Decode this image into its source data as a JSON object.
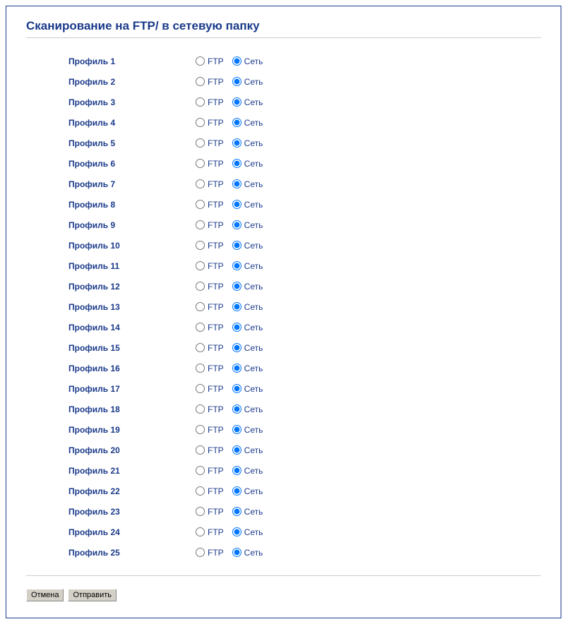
{
  "title": "Сканирование на FTP/ в сетевую папку",
  "labels": {
    "ftp": "FTP",
    "network": "Сеть"
  },
  "profiles": [
    {
      "label": "Профиль 1",
      "selected": "network"
    },
    {
      "label": "Профиль 2",
      "selected": "network"
    },
    {
      "label": "Профиль 3",
      "selected": "network"
    },
    {
      "label": "Профиль 4",
      "selected": "network"
    },
    {
      "label": "Профиль 5",
      "selected": "network"
    },
    {
      "label": "Профиль 6",
      "selected": "network"
    },
    {
      "label": "Профиль 7",
      "selected": "network"
    },
    {
      "label": "Профиль 8",
      "selected": "network"
    },
    {
      "label": "Профиль 9",
      "selected": "network"
    },
    {
      "label": "Профиль 10",
      "selected": "network"
    },
    {
      "label": "Профиль 11",
      "selected": "network"
    },
    {
      "label": "Профиль 12",
      "selected": "network"
    },
    {
      "label": "Профиль 13",
      "selected": "network"
    },
    {
      "label": "Профиль 14",
      "selected": "network"
    },
    {
      "label": "Профиль 15",
      "selected": "network"
    },
    {
      "label": "Профиль 16",
      "selected": "network"
    },
    {
      "label": "Профиль 17",
      "selected": "network"
    },
    {
      "label": "Профиль 18",
      "selected": "network"
    },
    {
      "label": "Профиль 19",
      "selected": "network"
    },
    {
      "label": "Профиль 20",
      "selected": "network"
    },
    {
      "label": "Профиль 21",
      "selected": "network"
    },
    {
      "label": "Профиль 22",
      "selected": "network"
    },
    {
      "label": "Профиль 23",
      "selected": "network"
    },
    {
      "label": "Профиль 24",
      "selected": "network"
    },
    {
      "label": "Профиль 25",
      "selected": "network"
    }
  ],
  "buttons": {
    "cancel": "Отмена",
    "submit": "Отправить"
  }
}
